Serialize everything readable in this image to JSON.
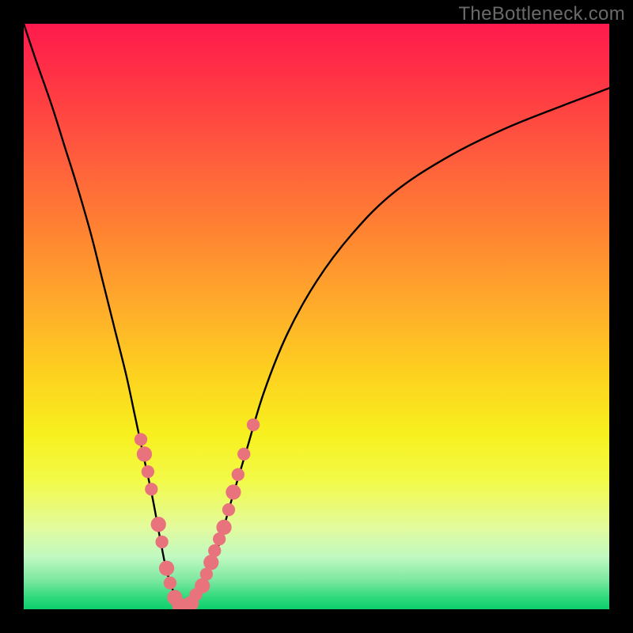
{
  "watermark": "TheBottleneck.com",
  "chart_data": {
    "type": "line",
    "title": "",
    "xlabel": "",
    "ylabel": "",
    "xlim": [
      0,
      100
    ],
    "ylim": [
      0,
      100
    ],
    "background_gradient": {
      "orientation": "vertical",
      "stops": [
        {
          "pos": 0.0,
          "color": "#ff1a4d"
        },
        {
          "pos": 0.5,
          "color": "#ffab2b"
        },
        {
          "pos": 0.75,
          "color": "#f4f828"
        },
        {
          "pos": 1.0,
          "color": "#0ecf6d"
        }
      ]
    },
    "series": [
      {
        "name": "left-curve",
        "x": [
          0.0,
          2.0,
          4.8,
          7.0,
          9.2,
          11.5,
          13.5,
          15.5,
          17.5,
          19.0,
          20.5,
          22.0,
          23.3,
          24.3,
          25.2,
          25.8,
          26.5,
          27.5
        ],
        "y": [
          100.0,
          94.0,
          86.0,
          79.0,
          72.0,
          64.0,
          56.0,
          48.0,
          40.0,
          33.0,
          26.0,
          19.0,
          12.0,
          7.0,
          4.0,
          2.5,
          1.0,
          0.0
        ]
      },
      {
        "name": "right-curve",
        "x": [
          27.5,
          29.0,
          31.0,
          33.0,
          35.3,
          38.0,
          41.0,
          45.0,
          50.0,
          56.0,
          63.0,
          72.0,
          82.0,
          92.0,
          100.0
        ],
        "y": [
          0.0,
          1.5,
          5.0,
          10.0,
          18.0,
          27.0,
          37.0,
          47.0,
          56.0,
          64.0,
          71.0,
          77.0,
          82.0,
          86.0,
          89.0
        ]
      }
    ],
    "markers": [
      {
        "x": 20.0,
        "y": 29.0,
        "r": 1.1
      },
      {
        "x": 20.6,
        "y": 26.5,
        "r": 1.3
      },
      {
        "x": 21.2,
        "y": 23.5,
        "r": 1.1
      },
      {
        "x": 21.8,
        "y": 20.5,
        "r": 1.1
      },
      {
        "x": 23.0,
        "y": 14.5,
        "r": 1.3
      },
      {
        "x": 23.6,
        "y": 11.5,
        "r": 1.1
      },
      {
        "x": 24.4,
        "y": 7.0,
        "r": 1.3
      },
      {
        "x": 25.0,
        "y": 4.5,
        "r": 1.1
      },
      {
        "x": 25.8,
        "y": 2.0,
        "r": 1.3
      },
      {
        "x": 26.6,
        "y": 0.7,
        "r": 1.3
      },
      {
        "x": 27.6,
        "y": 0.5,
        "r": 1.3
      },
      {
        "x": 28.6,
        "y": 1.0,
        "r": 1.3
      },
      {
        "x": 29.4,
        "y": 2.5,
        "r": 1.1
      },
      {
        "x": 30.5,
        "y": 4.0,
        "r": 1.3
      },
      {
        "x": 31.2,
        "y": 6.0,
        "r": 1.1
      },
      {
        "x": 32.0,
        "y": 8.0,
        "r": 1.3
      },
      {
        "x": 32.6,
        "y": 10.0,
        "r": 1.1
      },
      {
        "x": 33.4,
        "y": 12.0,
        "r": 1.1
      },
      {
        "x": 34.2,
        "y": 14.0,
        "r": 1.3
      },
      {
        "x": 35.0,
        "y": 17.0,
        "r": 1.1
      },
      {
        "x": 35.8,
        "y": 20.0,
        "r": 1.3
      },
      {
        "x": 36.6,
        "y": 23.0,
        "r": 1.1
      },
      {
        "x": 37.6,
        "y": 26.5,
        "r": 1.1
      },
      {
        "x": 39.2,
        "y": 31.5,
        "r": 1.1
      }
    ],
    "marker_color": "#e9737c"
  }
}
